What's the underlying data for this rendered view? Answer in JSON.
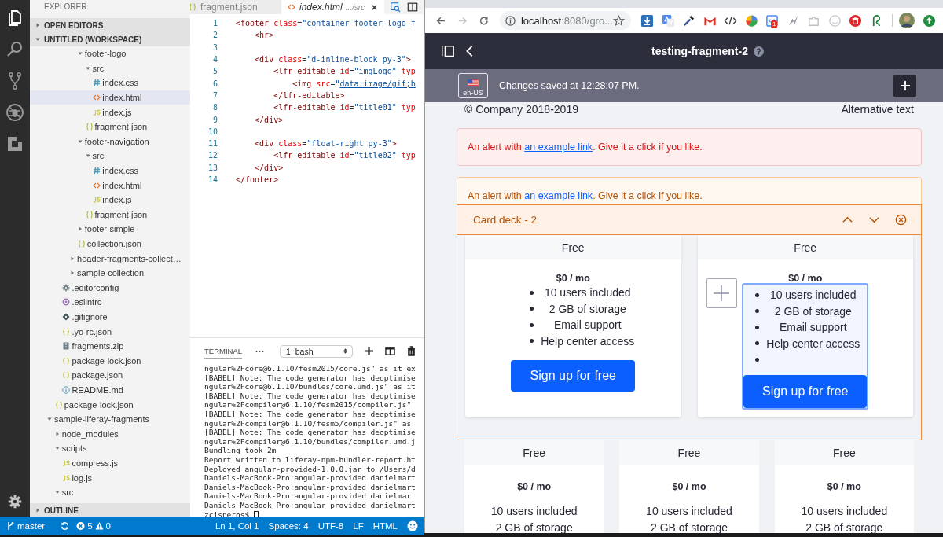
{
  "activity_bar": {
    "items": [
      {
        "kind": "files",
        "selected": true
      },
      {
        "kind": "search",
        "selected": false
      },
      {
        "kind": "source-control",
        "selected": false
      },
      {
        "kind": "debug",
        "selected": false
      },
      {
        "kind": "extensions",
        "selected": false
      }
    ]
  },
  "explorer": {
    "title": "EXPLORER",
    "sections": [
      {
        "label": "OPEN EDITORS",
        "expanded": false
      },
      {
        "label": "UNTITLED (WORKSPACE)",
        "expanded": true
      }
    ],
    "tree": [
      {
        "children": [
          {
            "children": [
              {
                "children": [
                  {
                    "children": [
                      {
                        "label": "footer-logo",
                        "kind": "folder",
                        "expanded": true,
                        "selected": false,
                        "children": [
                          {
                            "label": "src",
                            "kind": "folder",
                            "expanded": true,
                            "selected": false,
                            "children": [
                              {
                                "label": "index.css",
                                "kind": "css",
                                "selected": false
                              },
                              {
                                "label": "index.html",
                                "kind": "html",
                                "selected": true
                              },
                              {
                                "label": "index.js",
                                "kind": "js",
                                "selected": false
                              }
                            ]
                          },
                          {
                            "label": "fragment.json",
                            "kind": "json",
                            "selected": false
                          }
                        ]
                      },
                      {
                        "label": "footer-navigation",
                        "kind": "folder",
                        "expanded": true,
                        "selected": false,
                        "children": [
                          {
                            "label": "src",
                            "kind": "folder",
                            "expanded": true,
                            "selected": false,
                            "children": [
                              {
                                "label": "index.css",
                                "kind": "css",
                                "selected": false
                              },
                              {
                                "label": "index.html",
                                "kind": "html",
                                "selected": false
                              },
                              {
                                "label": "index.js",
                                "kind": "js",
                                "selected": false
                              }
                            ]
                          },
                          {
                            "label": "fragment.json",
                            "kind": "json",
                            "selected": false
                          }
                        ]
                      },
                      {
                        "label": "footer-simple",
                        "kind": "folder",
                        "expanded": false,
                        "selected": false
                      },
                      {
                        "label": "collection.json",
                        "kind": "json",
                        "selected": false
                      }
                    ]
                  },
                  {
                    "label": "header-fragments-collect…",
                    "kind": "folder",
                    "expanded": false,
                    "selected": false
                  },
                  {
                    "label": "sample-collection",
                    "kind": "folder",
                    "expanded": false,
                    "selected": false
                  }
                ]
              },
              {
                "label": ".editorconfig",
                "kind": "config",
                "selected": false
              },
              {
                "label": ".eslintrc",
                "kind": "eslint",
                "selected": false
              },
              {
                "label": ".gitignore",
                "kind": "git",
                "selected": false
              },
              {
                "label": ".yo-rc.json",
                "kind": "json",
                "selected": false
              },
              {
                "label": "fragments.zip",
                "kind": "zip",
                "selected": false
              },
              {
                "label": "package-lock.json",
                "kind": "json",
                "selected": false
              },
              {
                "label": "package.json",
                "kind": "json",
                "selected": false
              },
              {
                "label": "README.md",
                "kind": "readme",
                "selected": false
              }
            ]
          },
          {
            "label": "package-lock.json",
            "kind": "json",
            "selected": false
          }
        ]
      },
      {
        "label": "sample-liferay-fragments",
        "kind": "folder",
        "expanded": true,
        "selected": false,
        "children": [
          {
            "label": "node_modules",
            "kind": "folder",
            "expanded": false,
            "selected": false
          },
          {
            "label": "scripts",
            "kind": "folder",
            "expanded": true,
            "selected": false,
            "children": [
              {
                "label": "compress.js",
                "kind": "js",
                "selected": false
              },
              {
                "label": "log.js",
                "kind": "js",
                "selected": false
              }
            ]
          },
          {
            "label": "src",
            "kind": "folder",
            "expanded": true,
            "selected": false
          }
        ]
      }
    ],
    "outline": {
      "label": "OUTLINE",
      "expanded": false
    }
  },
  "editor": {
    "tabs": [
      {
        "label": "fragment.json",
        "kind": "json",
        "selected": false,
        "preview": false
      },
      {
        "label": "index.html",
        "path": ".../src",
        "kind": "html",
        "selected": true,
        "preview": true
      }
    ],
    "lines": [
      {
        "number": "1",
        "tokens": [
          {
            "kind": "tag",
            "text": "<footer"
          },
          {
            "kind": "attr",
            "text": " class"
          },
          {
            "kind": "punct",
            "text": "="
          },
          {
            "kind": "string",
            "text": "\"container footer-logo-f"
          }
        ]
      },
      {
        "number": "2",
        "tokens": [
          {
            "kind": "tag",
            "text": "    <hr>"
          }
        ]
      },
      {
        "number": "3"
      },
      {
        "number": "4",
        "tokens": [
          {
            "kind": "tag",
            "text": "    <div"
          },
          {
            "kind": "attr",
            "text": " class"
          },
          {
            "kind": "punct",
            "text": "="
          },
          {
            "kind": "string",
            "text": "\"d-inline-block py-3\""
          },
          {
            "kind": "tag",
            "text": ">"
          }
        ]
      },
      {
        "number": "5",
        "tokens": [
          {
            "kind": "tag",
            "text": "        <lfr-editable"
          },
          {
            "kind": "attr",
            "text": " id"
          },
          {
            "kind": "punct",
            "text": "="
          },
          {
            "kind": "string",
            "text": "\"imgLogo\""
          },
          {
            "kind": "attr",
            "text": " typ"
          }
        ]
      },
      {
        "number": "6",
        "tokens": [
          {
            "kind": "tag",
            "text": "            <img"
          },
          {
            "kind": "attr",
            "text": " src"
          },
          {
            "kind": "punct",
            "text": "="
          },
          {
            "kind": "string",
            "text": "\""
          },
          {
            "kind": "link",
            "text": "data:image/gif;b"
          }
        ]
      },
      {
        "number": "7",
        "tokens": [
          {
            "kind": "tag",
            "text": "        </lfr-editable>"
          }
        ]
      },
      {
        "number": "8",
        "tokens": [
          {
            "kind": "tag",
            "text": "        <lfr-editable"
          },
          {
            "kind": "attr",
            "text": " id"
          },
          {
            "kind": "punct",
            "text": "="
          },
          {
            "kind": "string",
            "text": "\"title01\""
          },
          {
            "kind": "attr",
            "text": " typ"
          }
        ]
      },
      {
        "number": "9",
        "tokens": [
          {
            "kind": "tag",
            "text": "    </div>"
          }
        ]
      },
      {
        "number": "10"
      },
      {
        "number": "11",
        "tokens": [
          {
            "kind": "tag",
            "text": "    <div"
          },
          {
            "kind": "attr",
            "text": " class"
          },
          {
            "kind": "punct",
            "text": "="
          },
          {
            "kind": "string",
            "text": "\"float-right py-3\""
          },
          {
            "kind": "tag",
            "text": ">"
          }
        ]
      },
      {
        "number": "12",
        "tokens": [
          {
            "kind": "tag",
            "text": "        <lfr-editable"
          },
          {
            "kind": "attr",
            "text": " id"
          },
          {
            "kind": "punct",
            "text": "="
          },
          {
            "kind": "string",
            "text": "\"title02\""
          },
          {
            "kind": "attr",
            "text": " typ"
          }
        ]
      },
      {
        "number": "13",
        "tokens": [
          {
            "kind": "tag",
            "text": "    </div>"
          }
        ]
      },
      {
        "number": "14",
        "tokens": [
          {
            "kind": "tag",
            "text": "</footer>"
          }
        ]
      }
    ]
  },
  "terminal": {
    "tab": "TERMINAL",
    "shell": "1: bash",
    "lines": [
      "ngular%2Fcore@6.1.10/fesm2015/core.js\" as it ex",
      "[BABEL] Note: The code generator has deoptimise",
      "ngular%2Fcore@6.1.10/bundles/core.umd.js\" as it",
      "[BABEL] Note: The code generator has deoptimise",
      "ngular%2Fcompiler@6.1.10/fesm2015/compiler.js\"",
      "[BABEL] Note: The code generator has deoptimise",
      "ngular%2Fcompiler@6.1.10/fesm5/compiler.js\" as",
      "[BABEL] Note: The code generator has deoptimise",
      "ngular%2Fcompiler@6.1.10/bundles/compiler.umd.j",
      "Bundling took 2m",
      "Report written to liferay-npm-bundler-report.ht",
      "Deployed angular-provided-1.0.0.jar to /Users/d",
      "Daniels-MacBook-Pro:angular-provided danielmart",
      "Daniels-MacBook-Pro:angular-provided danielmart",
      "Daniels-MacBook-Pro:angular-provided danielmart",
      "Daniels-MacBook-Pro:angular-provided danielmart",
      "zcisneros$ "
    ]
  },
  "status_bar": {
    "branch": "master",
    "errors": "5",
    "warnings": "0",
    "position": "Ln 1, Col 1",
    "indent": "Spaces: 4",
    "encoding": "UTF-8",
    "eol": "LF",
    "language": "HTML"
  },
  "browser": {
    "forward_enabled": false,
    "url_host": "localhost",
    "url_rest": ":8080/gro...",
    "extension_badge": "1"
  },
  "page": {
    "title": "testing-fragment-2",
    "locale": "en-US",
    "status": "Changes saved at 12:28:07 PM.",
    "footer": {
      "copyright": "© Company 2018-2019",
      "image_alt": "Alternative text"
    },
    "alerts": [
      {
        "kind": "danger",
        "before": "An alert with ",
        "link": "an example link",
        "after": ". Give it a click if you like."
      },
      {
        "kind": "warning",
        "before": "An alert with ",
        "link": "an example link",
        "after": ". Give it a click if you like."
      }
    ],
    "card_deck": {
      "title": "Card deck - 2",
      "cards": [
        {
          "header": "Free",
          "price": "$0 / mo",
          "features": [
            "10 users included",
            "2 GB of storage",
            "Email support",
            "Help center access"
          ],
          "button": "Sign up for free",
          "editing": false
        },
        {
          "header": "Free",
          "price": "$0 / mo",
          "features": [
            "10 users included",
            "2 GB of storage",
            "Email support",
            "Help center access"
          ],
          "button": "Sign up for free",
          "editing": true
        }
      ]
    },
    "cards": [
      {
        "header": "Free",
        "price": "$0 / mo",
        "features": [
          "10 users included",
          "2 GB of storage"
        ]
      },
      {
        "header": "Free",
        "price": "$0 / mo",
        "features": [
          "10 users included",
          "2 GB of storage"
        ]
      },
      {
        "header": "Free",
        "price": "$0 / mo",
        "features": [
          "10 users included",
          "2 GB of storage"
        ]
      }
    ]
  }
}
